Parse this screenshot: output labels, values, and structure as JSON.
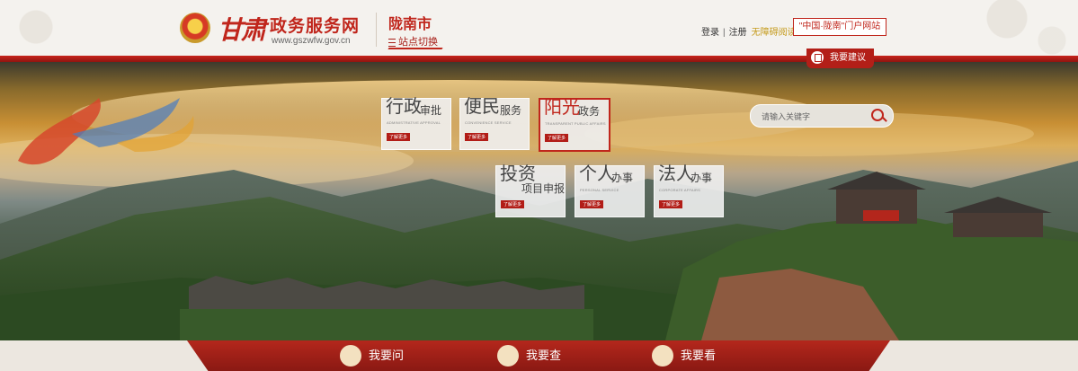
{
  "header": {
    "logo_script": "甘肃",
    "site_name": "政务服务网",
    "site_url": "www.gszwfw.gov.cn",
    "city": "陇南市",
    "site_switch": "站点切换",
    "login": "登录",
    "separator": "|",
    "register": "注册",
    "accessible": "无障碍阅读",
    "portal": "\"中国·陇南\"门户网站",
    "suggest": "我要建议"
  },
  "tiles": [
    {
      "big": "行政",
      "small": "审批",
      "en": "ADMINISTRATIVE APPROVAL",
      "more": "了解更多"
    },
    {
      "big": "便民",
      "small": "服务",
      "en": "CONVENIENCE SERVICE",
      "more": "了解更多"
    },
    {
      "big": "阳光",
      "small": "政务",
      "en": "TRANSPARENT PUBLIC AFFAIRS",
      "more": "了解更多"
    },
    {
      "big": "投资",
      "small": "项目申报",
      "en": "",
      "more": "了解更多"
    },
    {
      "big": "个人",
      "small": "办事",
      "en": "PERSONAL SERVICE",
      "more": "了解更多"
    },
    {
      "big": "法人",
      "small": "办事",
      "en": "CORPORATE AFFAIRS",
      "more": "了解更多"
    }
  ],
  "search": {
    "placeholder": "请输入关键字"
  },
  "bottom_nav": [
    {
      "label": "我要问",
      "icon": "chat-icon"
    },
    {
      "label": "我要查",
      "icon": "search-icon"
    },
    {
      "label": "我要看",
      "icon": "monitor-icon"
    }
  ],
  "colors": {
    "brand_red": "#c0261c",
    "dark_red": "#8f1510",
    "gold": "#c49a1a"
  }
}
